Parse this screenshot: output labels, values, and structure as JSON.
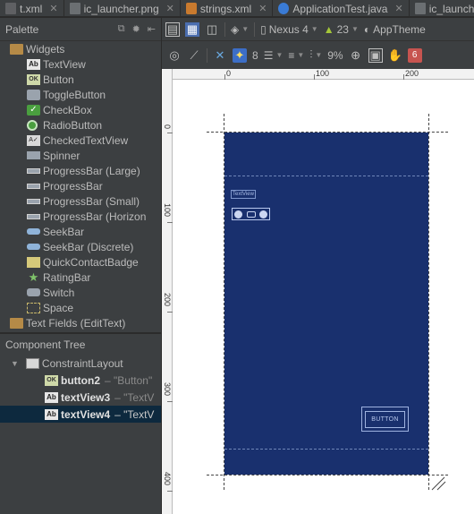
{
  "tabs": [
    {
      "label": "t.xml",
      "icon": "xml-file-icon"
    },
    {
      "label": "ic_launcher.png",
      "icon": "png-file-icon"
    },
    {
      "label": "strings.xml",
      "icon": "strings-file-icon"
    },
    {
      "label": "ApplicationTest.java",
      "icon": "java-file-icon"
    },
    {
      "label": "ic_launch",
      "icon": "png-file-icon"
    }
  ],
  "palette": {
    "title": "Palette",
    "groups": [
      {
        "label": "Widgets"
      },
      {
        "label": "Text Fields (EditText)"
      }
    ],
    "items": [
      {
        "label": "TextView",
        "icon_text": "Ab"
      },
      {
        "label": "Button",
        "icon_text": "OK"
      },
      {
        "label": "ToggleButton"
      },
      {
        "label": "CheckBox",
        "icon_text": "✓"
      },
      {
        "label": "RadioButton"
      },
      {
        "label": "CheckedTextView",
        "icon_text": "A✓"
      },
      {
        "label": "Spinner"
      },
      {
        "label": "ProgressBar (Large)"
      },
      {
        "label": "ProgressBar"
      },
      {
        "label": "ProgressBar (Small)"
      },
      {
        "label": "ProgressBar (Horizon"
      },
      {
        "label": "SeekBar"
      },
      {
        "label": "SeekBar (Discrete)"
      },
      {
        "label": "QuickContactBadge"
      },
      {
        "label": "RatingBar"
      },
      {
        "label": "Switch"
      },
      {
        "label": "Space"
      }
    ]
  },
  "component_tree": {
    "title": "Component Tree",
    "root": "ConstraintLayout",
    "children": [
      {
        "name": "button2",
        "hint": "– \"Button\"",
        "icon_text": "OK"
      },
      {
        "name": "textView3",
        "hint": "– \"TextV",
        "icon_text": "Ab"
      },
      {
        "name": "textView4",
        "hint": "– \"TextV",
        "icon_text": "Ab"
      }
    ]
  },
  "toolbar": {
    "device": "Nexus 4",
    "api": "23",
    "theme": "AppTheme",
    "margin": "8",
    "zoom": "9%",
    "warnings": "6"
  },
  "canvas": {
    "ruler_h": [
      "0",
      "100",
      "200"
    ],
    "ruler_v": [
      "0",
      "100",
      "200",
      "300",
      "400"
    ],
    "textview_label": "TextView",
    "button_label": "BUTTON"
  },
  "colors": {
    "device_bg": "#19306e",
    "ide_bg": "#3c3f41",
    "selection": "#0d293e"
  }
}
